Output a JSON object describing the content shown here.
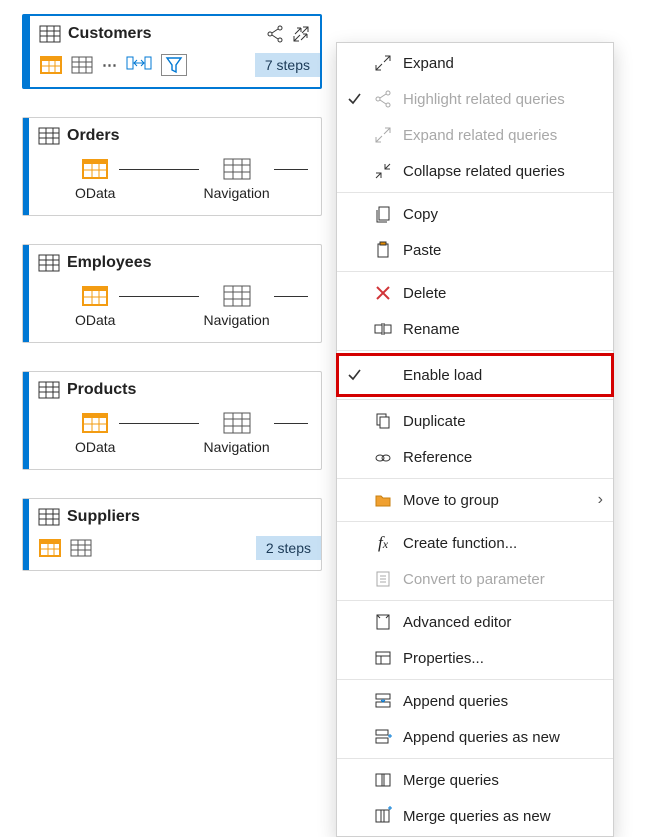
{
  "queries": [
    {
      "name": "Customers",
      "selected": true,
      "toolbar_steps": "7 steps",
      "show_toolbar": true
    },
    {
      "name": "Orders",
      "nodes": [
        "OData",
        "Navigation"
      ]
    },
    {
      "name": "Employees",
      "nodes": [
        "OData",
        "Navigation"
      ]
    },
    {
      "name": "Products",
      "nodes": [
        "OData",
        "Navigation"
      ]
    },
    {
      "name": "Suppliers",
      "toolbar_steps": "2 steps",
      "show_mini_toolbar": true
    }
  ],
  "menu_groups": [
    [
      {
        "label": "Expand",
        "icon": "expand-icon"
      },
      {
        "label": "Highlight related queries",
        "icon": "share-icon",
        "checked": true,
        "disabled": true
      },
      {
        "label": "Expand related queries",
        "icon": "expand-icon",
        "disabled": true
      },
      {
        "label": "Collapse related queries",
        "icon": "collapse-icon"
      }
    ],
    [
      {
        "label": "Copy",
        "icon": "copy-icon"
      },
      {
        "label": "Paste",
        "icon": "paste-icon"
      }
    ],
    [
      {
        "label": "Delete",
        "icon": "delete-icon"
      },
      {
        "label": "Rename",
        "icon": "rename-icon"
      }
    ],
    [
      {
        "label": "Enable load",
        "icon": "blank-icon",
        "checked": true,
        "highlight": true
      }
    ],
    [
      {
        "label": "Duplicate",
        "icon": "duplicate-icon"
      },
      {
        "label": "Reference",
        "icon": "reference-icon"
      }
    ],
    [
      {
        "label": "Move to group",
        "icon": "folder-icon",
        "has_submenu": true
      }
    ],
    [
      {
        "label": "Create function...",
        "icon": "fx-icon"
      },
      {
        "label": "Convert to parameter",
        "icon": "param-icon",
        "disabled": true
      }
    ],
    [
      {
        "label": "Advanced editor",
        "icon": "editor-icon"
      },
      {
        "label": "Properties...",
        "icon": "properties-icon"
      }
    ],
    [
      {
        "label": "Append queries",
        "icon": "append-icon"
      },
      {
        "label": "Append queries as new",
        "icon": "append-new-icon"
      }
    ],
    [
      {
        "label": "Merge queries",
        "icon": "merge-icon"
      },
      {
        "label": "Merge queries as new",
        "icon": "merge-new-icon"
      }
    ]
  ]
}
